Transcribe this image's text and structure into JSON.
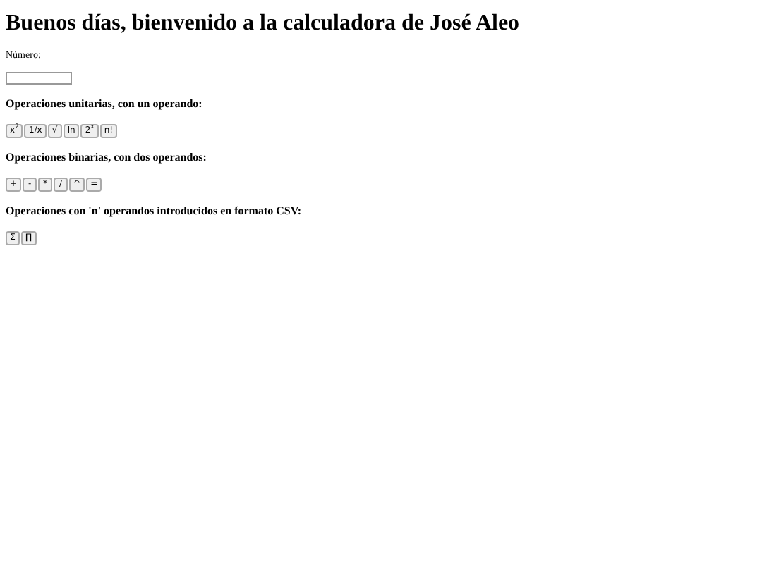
{
  "title": "Buenos días, bienvenido a la calculadora de José Aleo",
  "number_label": "Número:",
  "sections": [
    {
      "heading": "Operaciones unitarias, con un operando:",
      "buttons": [
        "x$^{2}$",
        "1/x",
        "√",
        "ln",
        "2$^{x}$",
        "n!"
      ]
    },
    {
      "heading": "Operaciones binarias, con dos operandos:",
      "buttons": [
        "+",
        "-",
        "*",
        "/",
        "^",
        "="
      ]
    },
    {
      "heading": "Operaciones con 'n' operandos introducidos en formato CSV:",
      "buttons": [
        "Σ",
        "∏"
      ]
    }
  ]
}
